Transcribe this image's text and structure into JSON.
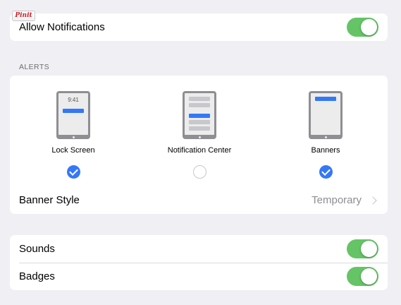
{
  "pinit": {
    "label": "Pinit"
  },
  "allow_notifications": {
    "label": "Allow Notifications",
    "enabled": true
  },
  "alerts": {
    "header": "ALERTS",
    "options": [
      {
        "label": "Lock Screen",
        "checked": true,
        "time": "9:41",
        "icon": "lock-screen-device-icon"
      },
      {
        "label": "Notification Center",
        "checked": false,
        "icon": "notification-center-device-icon"
      },
      {
        "label": "Banners",
        "checked": true,
        "icon": "banners-device-icon"
      }
    ],
    "banner_style": {
      "label": "Banner Style",
      "value": "Temporary"
    }
  },
  "sounds": {
    "label": "Sounds",
    "enabled": true
  },
  "badges": {
    "label": "Badges",
    "enabled": true
  },
  "colors": {
    "toggle_on": "#65c466",
    "check_blue": "#3478f6",
    "background": "#efeff4"
  }
}
